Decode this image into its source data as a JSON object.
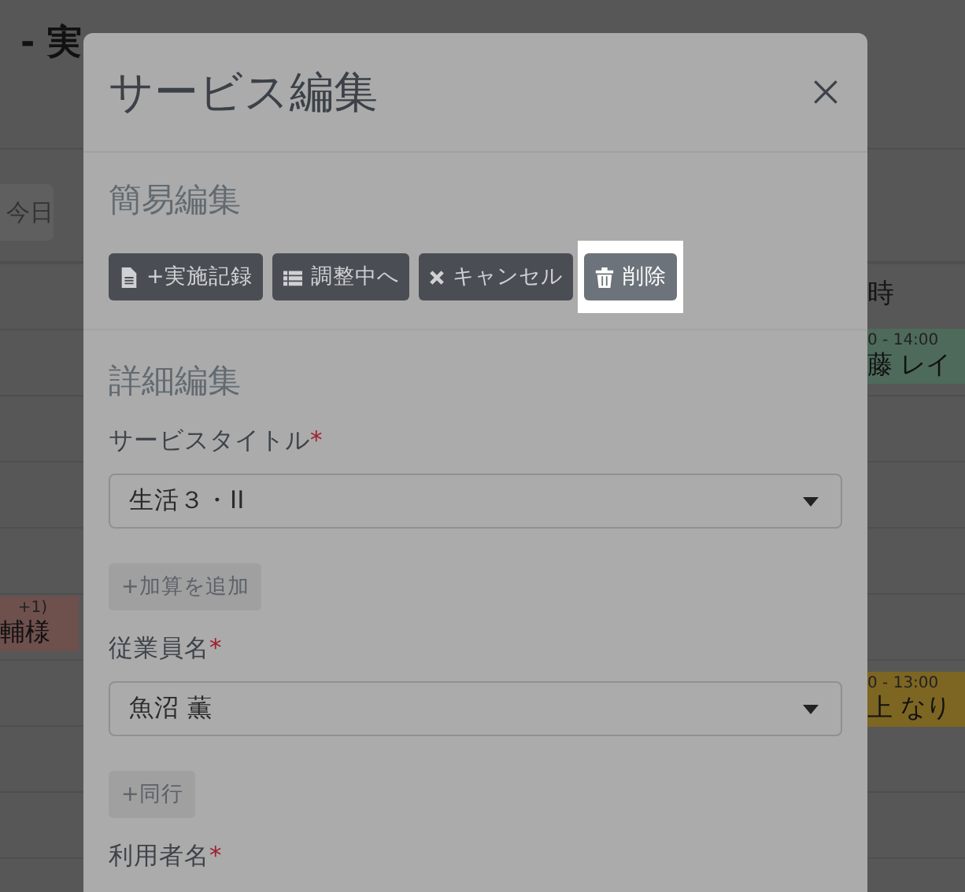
{
  "page": {
    "title": "- 実",
    "today_button": "今日",
    "column_header": "時",
    "left_events": [
      {
        "time": "+1)",
        "name": "輔様",
        "color": "#6e504c"
      }
    ],
    "right_events": [
      {
        "time": "0 - 14:00",
        "name": "藤 レイ",
        "color": "#4e6a5b"
      },
      {
        "time": "0 - 13:00",
        "name": "上 なり",
        "color": "#7d6522"
      }
    ]
  },
  "modal": {
    "title": "サービス編集",
    "quick_edit": {
      "heading": "簡易編集",
      "buttons": [
        {
          "label": "+実施記録",
          "highlighted": false
        },
        {
          "label": "調整中へ",
          "highlighted": false
        },
        {
          "label": "キャンセル",
          "highlighted": false
        },
        {
          "label": "削除",
          "highlighted": true
        }
      ]
    },
    "detail_edit": {
      "heading": "詳細編集",
      "fields": [
        {
          "kind": "select",
          "label": "サービスタイトル",
          "required_mark": "*",
          "value": "生活３・II"
        },
        {
          "kind": "button",
          "label": "+加算を追加"
        },
        {
          "kind": "select",
          "label": "従業員名",
          "required_mark": "*",
          "value": "魚沼 薫"
        },
        {
          "kind": "button",
          "label": "+同行"
        },
        {
          "kind": "label",
          "label": "利用者名",
          "required_mark": "*"
        }
      ]
    }
  }
}
